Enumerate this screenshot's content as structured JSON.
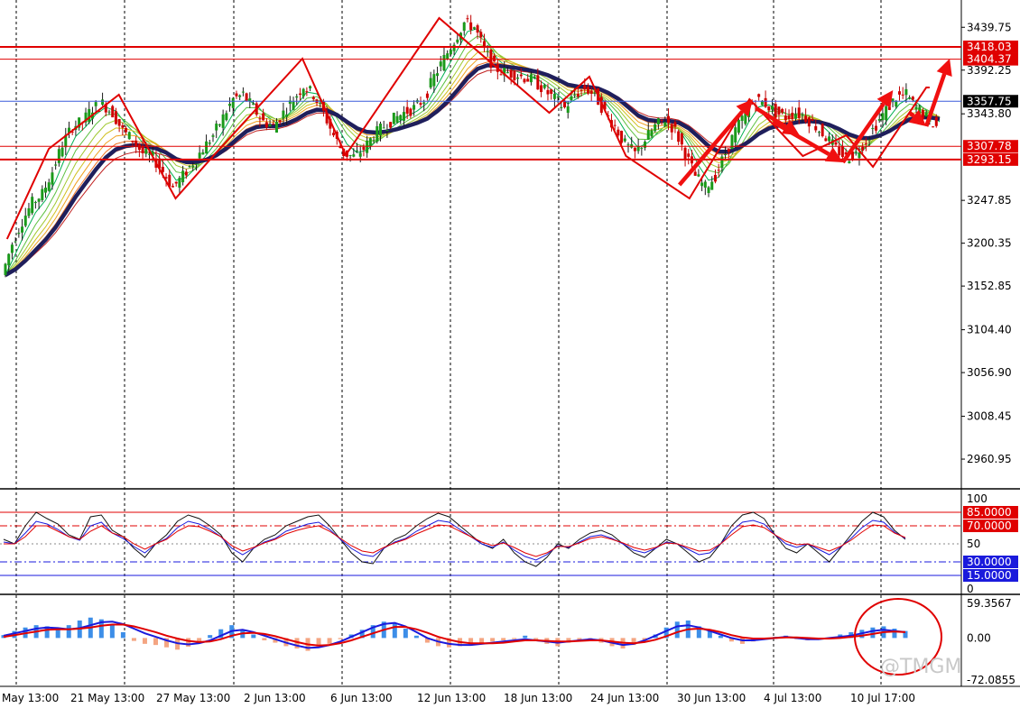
{
  "chart_data": [
    {
      "type": "candlestick",
      "panel": "price",
      "ylim": [
        2930,
        3470
      ],
      "y_ticks": [
        "3439.75",
        "3392.25",
        "3343.80",
        "3247.85",
        "3200.35",
        "3152.85",
        "3104.40",
        "3056.90",
        "3008.45",
        "2960.95"
      ],
      "x_ticks": [
        "May 13:00",
        "21 May 13:00",
        "27 May 13:00",
        "2 Jun 13:00",
        "6 Jun 13:00",
        "12 Jun 13:00",
        "18 Jun 13:00",
        "24 Jun 13:00",
        "30 Jun 13:00",
        "4 Jul 13:00",
        "10 Jul 17:00"
      ],
      "levels": [
        {
          "label": "3418.03",
          "value": 3418.03,
          "color": "#e00000",
          "style": "bold"
        },
        {
          "label": "3404.37",
          "value": 3404.37,
          "color": "#e00000",
          "style": "thin"
        },
        {
          "label": "3357.75",
          "value": 3357.75,
          "color": "#3b5bdb",
          "style": "current"
        },
        {
          "label": "3307.78",
          "value": 3307.78,
          "color": "#e00000",
          "style": "thin"
        },
        {
          "label": "3293.15",
          "value": 3293.15,
          "color": "#e00000",
          "style": "bold"
        }
      ],
      "close_series": [
        3165,
        3200,
        3225,
        3245,
        3255,
        3280,
        3310,
        3330,
        3335,
        3350,
        3355,
        3345,
        3325,
        3315,
        3300,
        3295,
        3280,
        3262,
        3275,
        3290,
        3305,
        3320,
        3340,
        3360,
        3365,
        3350,
        3335,
        3330,
        3345,
        3360,
        3375,
        3365,
        3345,
        3320,
        3300,
        3296,
        3305,
        3320,
        3330,
        3338,
        3345,
        3350,
        3360,
        3385,
        3405,
        3425,
        3445,
        3440,
        3415,
        3395,
        3390,
        3388,
        3384,
        3380,
        3370,
        3360,
        3350,
        3365,
        3372,
        3365,
        3345,
        3330,
        3310,
        3300,
        3315,
        3330,
        3338,
        3325,
        3300,
        3275,
        3262,
        3275,
        3300,
        3325,
        3345,
        3360,
        3355,
        3345,
        3340,
        3345,
        3340,
        3330,
        3318,
        3305,
        3295,
        3300,
        3315,
        3332,
        3348,
        3362,
        3365,
        3350,
        3340,
        3330
      ],
      "zigzag": [
        {
          "x": 0.05,
          "y": 3205
        },
        {
          "x": 1.3,
          "y": 3305
        },
        {
          "x": 3.4,
          "y": 3365
        },
        {
          "x": 5.1,
          "y": 3250
        },
        {
          "x": 6.3,
          "y": 3300
        },
        {
          "x": 8.9,
          "y": 3405
        },
        {
          "x": 10.2,
          "y": 3298
        },
        {
          "x": 13.0,
          "y": 3450
        },
        {
          "x": 16.3,
          "y": 3345
        },
        {
          "x": 17.5,
          "y": 3385
        },
        {
          "x": 18.6,
          "y": 3297
        },
        {
          "x": 20.5,
          "y": 3250
        },
        {
          "x": 22.3,
          "y": 3360
        },
        {
          "x": 23.9,
          "y": 3297
        },
        {
          "x": 25.2,
          "y": 3320
        },
        {
          "x": 26.0,
          "y": 3285
        },
        {
          "x": 27.6,
          "y": 3373
        },
        {
          "x": 27.7,
          "y": 3373
        }
      ],
      "arrows": [
        {
          "from": [
            20.2,
            3265
          ],
          "to": [
            22.4,
            3360
          ]
        },
        {
          "from": [
            22.5,
            3350
          ],
          "to": [
            23.8,
            3320
          ]
        },
        {
          "from": [
            23.0,
            3335
          ],
          "to": [
            25.1,
            3290
          ]
        },
        {
          "from": [
            25.1,
            3290
          ],
          "to": [
            26.6,
            3370
          ]
        },
        {
          "from": [
            27.1,
            3345
          ],
          "to": [
            27.6,
            3330
          ]
        },
        {
          "from": [
            27.6,
            3330
          ],
          "to": [
            28.3,
            3405
          ]
        }
      ]
    },
    {
      "type": "line",
      "panel": "oscillator",
      "ylim": [
        0,
        100
      ],
      "y_ticks": [
        "100",
        "50",
        "0"
      ],
      "levels": [
        {
          "label": "85.0000",
          "value": 85,
          "color": "#e00000",
          "style": "solid"
        },
        {
          "label": "70.0000",
          "value": 70,
          "color": "#e00000",
          "style": "dashdot"
        },
        {
          "label": "30.0000",
          "value": 30,
          "color": "#1a1adc",
          "style": "dashdot"
        },
        {
          "label": "15.0000",
          "value": 15,
          "color": "#1a1adc",
          "style": "solid"
        }
      ],
      "series": [
        {
          "values": [
            55,
            50,
            70,
            85,
            78,
            72,
            60,
            55,
            80,
            82,
            65,
            58,
            45,
            35,
            50,
            60,
            75,
            82,
            78,
            70,
            60,
            40,
            30,
            45,
            55,
            60,
            70,
            75,
            80,
            82,
            70,
            55,
            40,
            30,
            28,
            45,
            55,
            60,
            70,
            78,
            84,
            80,
            70,
            60,
            50,
            45,
            55,
            40,
            30,
            25,
            35,
            50,
            45,
            55,
            62,
            65,
            60,
            50,
            40,
            35,
            45,
            55,
            50,
            40,
            30,
            35,
            50,
            70,
            82,
            85,
            78,
            60,
            45,
            40,
            50,
            40,
            30,
            45,
            60,
            75,
            85,
            80,
            65,
            55
          ],
          "color": "#111111"
        },
        {
          "values": [
            52,
            50,
            62,
            75,
            72,
            66,
            58,
            54,
            70,
            74,
            62,
            56,
            47,
            40,
            50,
            56,
            68,
            75,
            72,
            66,
            58,
            45,
            38,
            45,
            52,
            56,
            64,
            68,
            72,
            74,
            66,
            55,
            45,
            38,
            36,
            45,
            52,
            56,
            64,
            70,
            76,
            74,
            66,
            58,
            50,
            46,
            52,
            43,
            36,
            32,
            38,
            48,
            46,
            52,
            58,
            60,
            56,
            50,
            43,
            40,
            45,
            52,
            50,
            44,
            38,
            40,
            50,
            64,
            74,
            76,
            72,
            60,
            50,
            46,
            50,
            44,
            38,
            46,
            56,
            68,
            76,
            74,
            63,
            56
          ],
          "color": "#1a1adc"
        },
        {
          "values": [
            50,
            50,
            58,
            70,
            70,
            64,
            58,
            55,
            64,
            70,
            62,
            58,
            50,
            44,
            50,
            55,
            64,
            70,
            69,
            64,
            58,
            48,
            42,
            46,
            51,
            55,
            61,
            65,
            68,
            70,
            64,
            56,
            48,
            42,
            40,
            46,
            51,
            55,
            61,
            66,
            71,
            70,
            64,
            58,
            52,
            48,
            51,
            46,
            40,
            36,
            40,
            47,
            47,
            51,
            56,
            58,
            55,
            51,
            46,
            43,
            46,
            51,
            50,
            46,
            42,
            43,
            50,
            60,
            69,
            71,
            68,
            60,
            53,
            49,
            50,
            46,
            42,
            47,
            54,
            63,
            71,
            70,
            62,
            57
          ],
          "color": "#e00000"
        }
      ]
    },
    {
      "type": "bar",
      "panel": "macd",
      "ylim": [
        -72.0855,
        59.3567
      ],
      "y_ticks": [
        "59.3567",
        "0.00",
        "-72.0855"
      ],
      "histogram": [
        5,
        12,
        18,
        22,
        20,
        15,
        22,
        30,
        35,
        32,
        22,
        10,
        -5,
        -10,
        -12,
        -16,
        -20,
        -15,
        -6,
        5,
        15,
        22,
        14,
        6,
        -4,
        -8,
        -14,
        -18,
        -22,
        -16,
        -10,
        -2,
        6,
        14,
        22,
        28,
        26,
        16,
        4,
        -8,
        -14,
        -16,
        -14,
        -12,
        -10,
        -6,
        -4,
        -2,
        4,
        -4,
        -10,
        -14,
        -8,
        -4,
        -2,
        -8,
        -14,
        -18,
        -12,
        -4,
        6,
        18,
        28,
        30,
        20,
        12,
        4,
        -6,
        -10,
        -6,
        -2,
        2,
        4,
        -2,
        -4,
        -2,
        0,
        6,
        10,
        14,
        18,
        20,
        16,
        12
      ],
      "series": [
        {
          "values": [
            4,
            8,
            12,
            16,
            18,
            17,
            15,
            17,
            22,
            27,
            28,
            24,
            16,
            8,
            2,
            -4,
            -9,
            -11,
            -9,
            -4,
            4,
            12,
            14,
            10,
            4,
            -2,
            -8,
            -13,
            -17,
            -16,
            -12,
            -6,
            2,
            10,
            18,
            24,
            26,
            20,
            10,
            0,
            -6,
            -10,
            -12,
            -12,
            -10,
            -8,
            -6,
            -4,
            -2,
            -4,
            -6,
            -8,
            -6,
            -4,
            -2,
            -4,
            -8,
            -12,
            -10,
            -4,
            4,
            12,
            20,
            22,
            18,
            12,
            6,
            0,
            -4,
            -4,
            -2,
            0,
            2,
            0,
            -2,
            -2,
            0,
            2,
            4,
            8,
            12,
            14,
            12,
            10
          ],
          "color": "#1a1adc"
        },
        {
          "values": [
            2,
            5,
            8,
            11,
            14,
            15,
            15,
            16,
            18,
            21,
            23,
            23,
            20,
            15,
            10,
            4,
            -1,
            -5,
            -7,
            -6,
            -2,
            4,
            8,
            9,
            7,
            3,
            -2,
            -7,
            -11,
            -13,
            -12,
            -9,
            -4,
            2,
            8,
            14,
            19,
            19,
            15,
            9,
            2,
            -3,
            -7,
            -9,
            -9,
            -9,
            -8,
            -6,
            -4,
            -4,
            -5,
            -6,
            -6,
            -5,
            -4,
            -4,
            -6,
            -8,
            -9,
            -7,
            -3,
            3,
            10,
            15,
            16,
            14,
            10,
            5,
            1,
            -1,
            -1,
            0,
            1,
            1,
            0,
            -1,
            -1,
            0,
            2,
            4,
            7,
            10,
            11,
            10
          ],
          "color": "#e00000"
        }
      ]
    }
  ],
  "watermark": "@TMGM"
}
